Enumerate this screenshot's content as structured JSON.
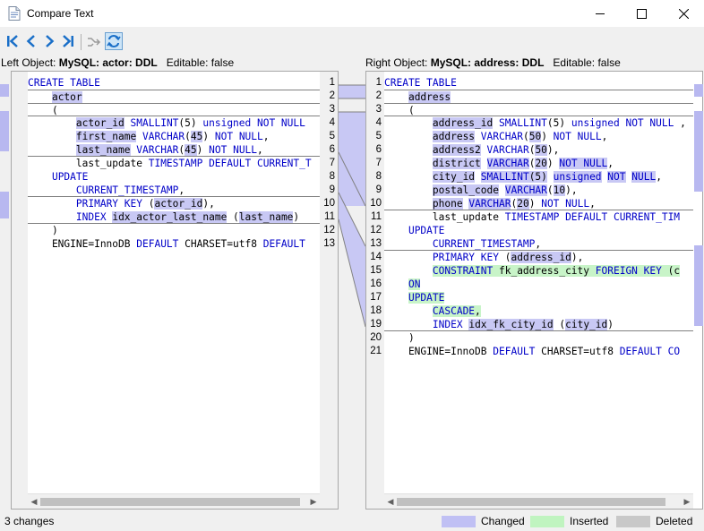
{
  "window": {
    "title": "Compare Text"
  },
  "toolbar": {
    "first_diff": "first-difference-icon",
    "prev_diff": "previous-difference-icon",
    "next_diff": "next-difference-icon",
    "last_diff": "last-difference-icon",
    "merge": "merge-arrow-icon",
    "sync_scroll": "sync-scroll-icon"
  },
  "left": {
    "label_prefix": "Left Object:",
    "object": "MySQL: actor: DDL",
    "editable": "Editable: false",
    "lines": [
      {
        "n": "1",
        "segs": [
          {
            "t": "CREATE TABLE",
            "c": "kw"
          }
        ]
      },
      {
        "n": "2",
        "segs": [
          {
            "t": "    "
          },
          {
            "t": "actor",
            "c": "ch"
          }
        ]
      },
      {
        "n": "3",
        "segs": [
          {
            "t": "    ("
          }
        ]
      },
      {
        "n": "4",
        "segs": [
          {
            "t": "        actor_id SMALLINT(5) unsigned NOT NULL",
            "c": "kwmix1"
          }
        ]
      },
      {
        "n": "5",
        "segs": [
          {
            "t": "        first_name VARCHAR(45) NOT NULL,",
            "c": "kwmix2"
          }
        ]
      },
      {
        "n": "6",
        "segs": [
          {
            "t": "        last_name VARCHAR(45) NOT NULL,",
            "c": "kwmix3"
          }
        ]
      },
      {
        "n": "7",
        "segs": [
          {
            "t": "        last_update TIMESTAMP DEFAULT CURRENT_T",
            "c": "kwmix4"
          }
        ]
      },
      {
        "n": "8",
        "segs": [
          {
            "t": "    UPDATE",
            "c": "kw"
          }
        ]
      },
      {
        "n": "9",
        "segs": [
          {
            "t": "        CURRENT_TIMESTAMP,",
            "c": "kw"
          }
        ]
      },
      {
        "n": "10",
        "segs": [
          {
            "t": "        PRIMARY KEY (actor_id),",
            "c": "kwmix5"
          }
        ]
      },
      {
        "n": "11",
        "segs": [
          {
            "t": "        INDEX idx_actor_last_name (last_name)",
            "c": "kwmix6"
          }
        ]
      },
      {
        "n": "12",
        "segs": [
          {
            "t": "    )"
          }
        ]
      },
      {
        "n": "13",
        "segs": [
          {
            "t": "    ENGINE=InnoDB DEFAULT CHARSET=utf8 DEFAULT",
            "c": "kwmix7"
          }
        ]
      }
    ]
  },
  "right": {
    "label_prefix": "Right Object:",
    "object": "MySQL: address: DDL",
    "editable": "Editable: false",
    "lines": [
      {
        "n": "1",
        "text": "CREATE TABLE"
      },
      {
        "n": "2",
        "text": "    address"
      },
      {
        "n": "3",
        "text": "    ("
      },
      {
        "n": "4",
        "text": "        address_id SMALLINT(5) unsigned NOT NULL ,"
      },
      {
        "n": "5",
        "text": "        address VARCHAR(50) NOT NULL,"
      },
      {
        "n": "6",
        "text": "        address2 VARCHAR(50),"
      },
      {
        "n": "7",
        "text": "        district VARCHAR(20) NOT NULL,"
      },
      {
        "n": "8",
        "text": "        city_id SMALLINT(5) unsigned NOT NULL,"
      },
      {
        "n": "9",
        "text": "        postal_code VARCHAR(10),"
      },
      {
        "n": "10",
        "text": "        phone VARCHAR(20) NOT NULL,"
      },
      {
        "n": "11",
        "text": "        last_update TIMESTAMP DEFAULT CURRENT_TIM"
      },
      {
        "n": "12",
        "text": "    UPDATE"
      },
      {
        "n": "13",
        "text": "        CURRENT_TIMESTAMP,"
      },
      {
        "n": "14",
        "text": "        PRIMARY KEY (address_id),"
      },
      {
        "n": "15",
        "text": "        CONSTRAINT fk_address_city FOREIGN KEY (c"
      },
      {
        "n": "16",
        "text": "    ON"
      },
      {
        "n": "17",
        "text": "    UPDATE"
      },
      {
        "n": "18",
        "text": "        CASCADE,"
      },
      {
        "n": "19",
        "text": "        INDEX idx_fk_city_id (city_id)"
      },
      {
        "n": "20",
        "text": "    )"
      },
      {
        "n": "21",
        "text": "    ENGINE=InnoDB DEFAULT CHARSET=utf8 DEFAULT CO"
      }
    ]
  },
  "status": {
    "changes": "3 changes",
    "legend_changed": "Changed",
    "legend_inserted": "Inserted",
    "legend_deleted": "Deleted"
  },
  "colors": {
    "changed": "#c0c0f4",
    "inserted": "#c0f4c0",
    "deleted": "#c8c8c8",
    "keyword": "#0000c8"
  }
}
